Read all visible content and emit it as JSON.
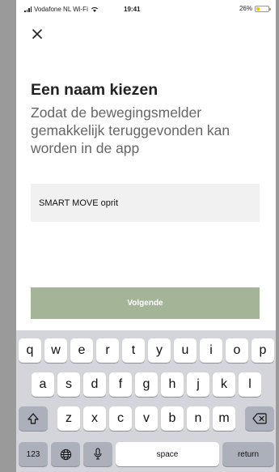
{
  "status_bar": {
    "carrier": "Vodafone NL Wi-Fi",
    "time": "19:41",
    "battery": "26%",
    "battery_level": 0.26
  },
  "header": {
    "close_icon": "close-icon"
  },
  "main": {
    "title": "Een naam kiezen",
    "subtitle": "Zodat de bewegingsmelder gemakkelijk teruggevonden kan worden in de app",
    "name_value": "SMART MOVE oprit",
    "next_label": "Volgende"
  },
  "keyboard": {
    "row1": [
      "q",
      "w",
      "e",
      "r",
      "t",
      "y",
      "u",
      "i",
      "o",
      "p"
    ],
    "row2": [
      "a",
      "s",
      "d",
      "f",
      "g",
      "h",
      "j",
      "k",
      "l"
    ],
    "row3": [
      "z",
      "x",
      "c",
      "v",
      "b",
      "n",
      "m"
    ],
    "numbers_label": "123",
    "space_label": "space",
    "return_label": "return",
    "icons": [
      "shift-icon",
      "backspace-icon",
      "globe-icon",
      "microphone-icon"
    ]
  },
  "colors": {
    "button": "#a3b596",
    "input_bg": "#f1f1f1",
    "keyboard_bg": "#d3d5db"
  }
}
